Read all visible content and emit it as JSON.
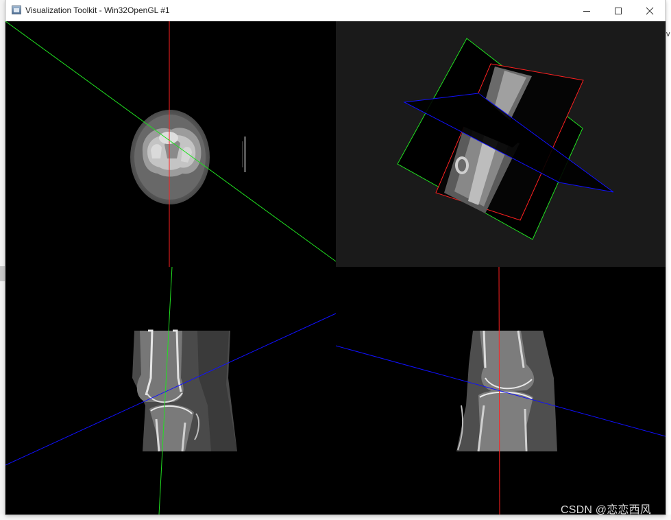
{
  "window": {
    "title": "Visualization Toolkit - Win32OpenGL #1",
    "controls": {
      "minimize_icon": "minimize-icon",
      "maximize_icon": "maximize-icon",
      "close_icon": "close-icon"
    }
  },
  "viewports": [
    {
      "name": "axial-view",
      "background": "#000000"
    },
    {
      "name": "3d-view",
      "background": "#1a1a1a"
    },
    {
      "name": "coronal-view",
      "background": "#000000"
    },
    {
      "name": "sagittal-view",
      "background": "#000000"
    }
  ],
  "colors": {
    "red_cursor": "#ff2020",
    "green_cursor": "#20e020",
    "blue_cursor": "#1010ff"
  },
  "watermark": {
    "text": "CSDN @恋恋西风"
  }
}
